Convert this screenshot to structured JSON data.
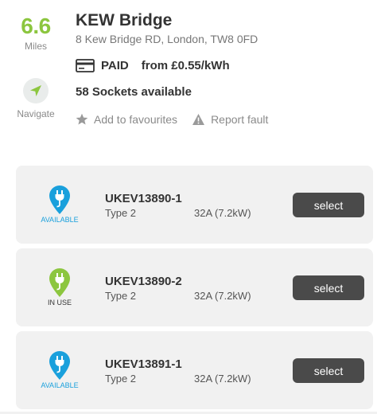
{
  "distance": {
    "value": "6.6",
    "unit": "Miles"
  },
  "navigate": {
    "label": "Navigate",
    "icon": "navigation-arrow-icon"
  },
  "station": {
    "title": "KEW Bridge",
    "address": "8 Kew Bridge RD, London, TW8 0FD",
    "payment_status": "PAID",
    "price": "from £0.55/kWh",
    "sockets_available": "58 Sockets available"
  },
  "actions": {
    "favourites": "Add to favourites",
    "report": "Report fault"
  },
  "sockets": [
    {
      "id": "UKEV13890-1",
      "type": "Type 2",
      "power": "32A (7.2kW)",
      "status": "AVAILABLE",
      "status_color": "#1aa0dc",
      "button": "select"
    },
    {
      "id": "UKEV13890-2",
      "type": "Type 2",
      "power": "32A (7.2kW)",
      "status": "IN USE",
      "status_color": "#8cc63f",
      "button": "select"
    },
    {
      "id": "UKEV13891-1",
      "type": "Type 2",
      "power": "32A (7.2kW)",
      "status": "AVAILABLE",
      "status_color": "#1aa0dc",
      "button": "select"
    }
  ],
  "colors": {
    "accent_green": "#8cc63f",
    "available_blue": "#1aa0dc",
    "button_dark": "#4a4a4a",
    "card_bg": "#f1f1f1"
  }
}
